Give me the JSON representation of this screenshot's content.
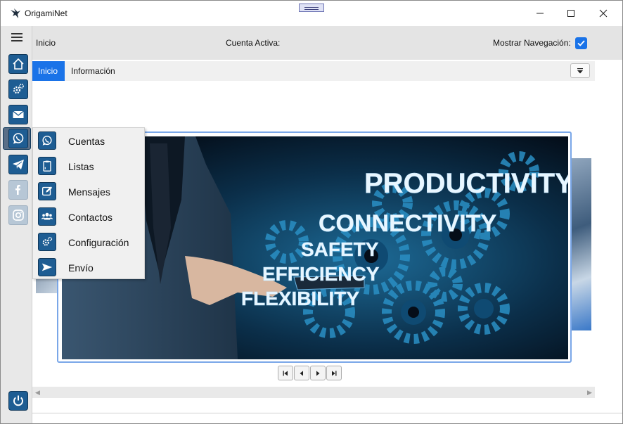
{
  "window": {
    "title": "OrigamiNet",
    "logo_icon": "origami-bird-icon",
    "controls": {
      "minimize_icon": "minimize-icon",
      "maximize_icon": "maximize-icon",
      "close_icon": "close-icon"
    }
  },
  "sidebar": {
    "menu_icon": "hamburger-menu-icon",
    "items": [
      {
        "name": "home",
        "icon": "home-icon"
      },
      {
        "name": "settings",
        "icon": "gears-icon"
      },
      {
        "name": "email",
        "icon": "envelope-icon"
      },
      {
        "name": "whatsapp",
        "icon": "whatsapp-icon",
        "selected": true
      },
      {
        "name": "telegram",
        "icon": "telegram-icon"
      },
      {
        "name": "facebook",
        "icon": "facebook-icon",
        "disabled": true
      },
      {
        "name": "instagram",
        "icon": "instagram-icon",
        "disabled": true
      }
    ],
    "power_icon": "power-icon"
  },
  "topbar": {
    "page": "Inicio",
    "active_account_label": "Cuenta Activa:",
    "show_nav_label": "Mostrar Navegación:",
    "show_nav_checked": true
  },
  "tabs": {
    "items": [
      {
        "label": "Inicio",
        "active": true
      },
      {
        "label": "Información",
        "active": false
      }
    ],
    "dropdown_icon": "dropdown-triangle-icon"
  },
  "carousel": {
    "image_words": [
      "PRODUCTIVITY",
      "CONNECTIVITY",
      "SAFETY",
      "EFFICIENCY",
      "FLEXIBILITY"
    ],
    "controls": [
      "first-icon",
      "previous-icon",
      "next-icon",
      "last-icon"
    ]
  },
  "whatsapp_menu": {
    "items": [
      {
        "label": "Cuentas",
        "icon": "whatsapp-icon"
      },
      {
        "label": "Listas",
        "icon": "clipboard-list-icon"
      },
      {
        "label": "Mensajes",
        "icon": "edit-message-icon"
      },
      {
        "label": "Contactos",
        "icon": "contacts-group-icon"
      },
      {
        "label": "Configuración",
        "icon": "gears-icon"
      },
      {
        "label": "Envío",
        "icon": "send-arrow-icon"
      }
    ]
  },
  "colors": {
    "accent": "#1a73e8",
    "sidebar_button": "#1e5d93",
    "topbar_bg": "#e4e4e4"
  }
}
